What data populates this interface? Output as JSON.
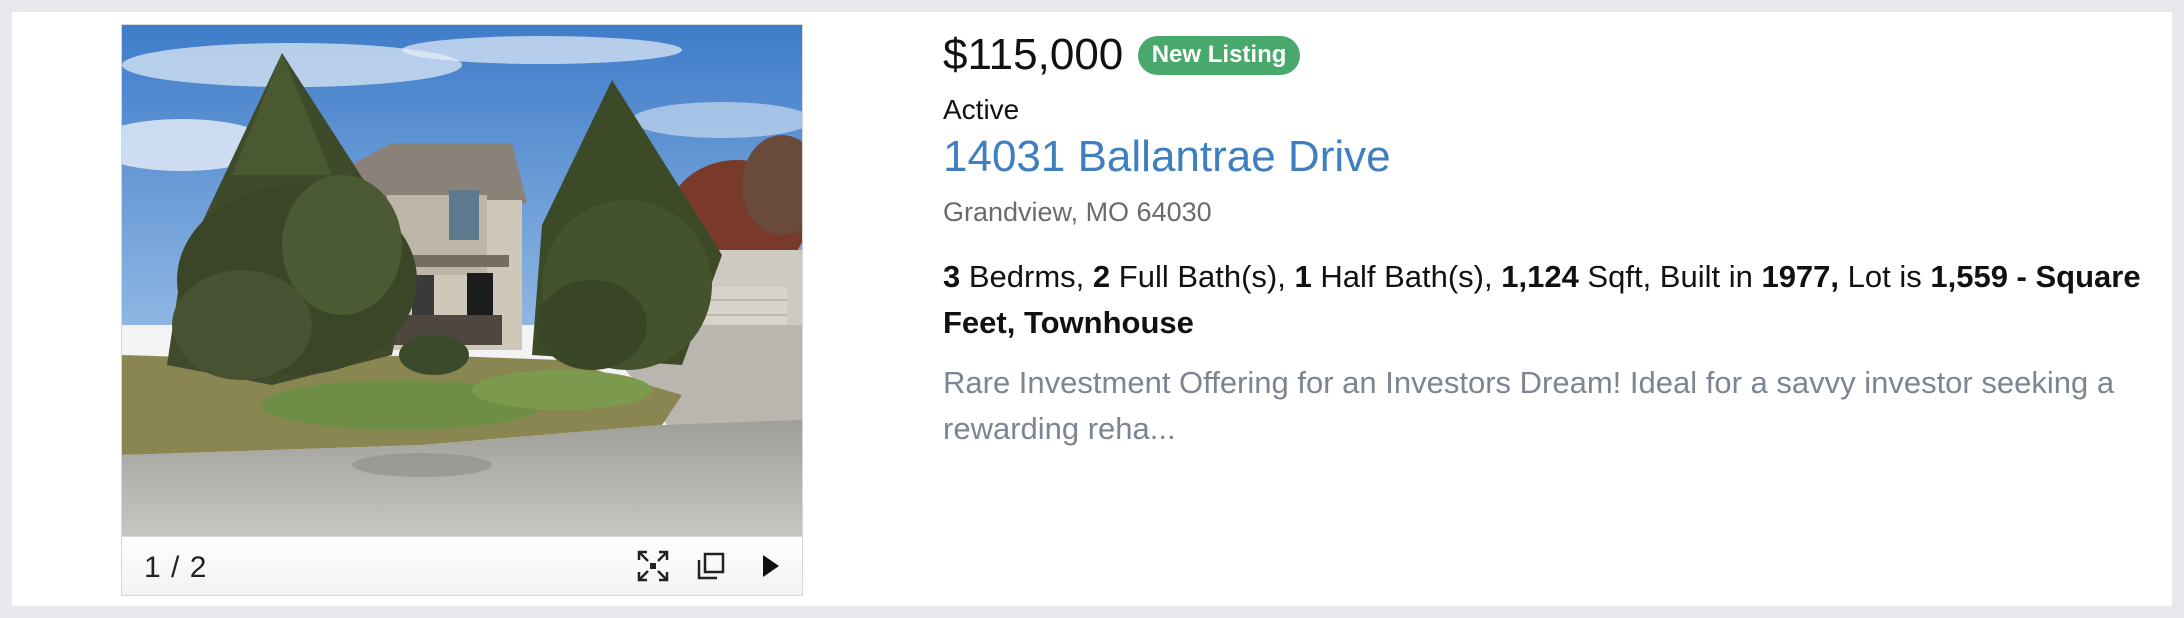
{
  "listing": {
    "price": "$115,000",
    "badge": "New Listing",
    "status": "Active",
    "address": "14031 Ballantrae Drive",
    "city_line": "Grandview, MO 64030",
    "facts": {
      "beds_value": "3",
      "beds_label": " Bedrms, ",
      "full_baths_value": "2",
      "full_baths_label": " Full Bath(s), ",
      "half_baths_value": "1",
      "half_baths_label": " Half Bath(s), ",
      "sqft_value": "1,124",
      "sqft_label": " Sqft, Built in ",
      "year_value": "1977,",
      "lot_label": " Lot is ",
      "lot_value": "1,559 - Square Feet, Townhouse"
    },
    "description": "Rare Investment Offering for an Investors Dream! Ideal for a savvy investor seeking a rewarding reha..."
  },
  "gallery": {
    "counter": "1 / 2",
    "icons": {
      "expand": "fullscreen-expand-icon",
      "popout": "open-in-new-window-icon",
      "next": "play-next-triangle-icon"
    }
  },
  "colors": {
    "page_background": "#e7e7ed",
    "badge": "#49a86b",
    "address_link": "#3f7fbf",
    "description_text": "#7c8590"
  }
}
